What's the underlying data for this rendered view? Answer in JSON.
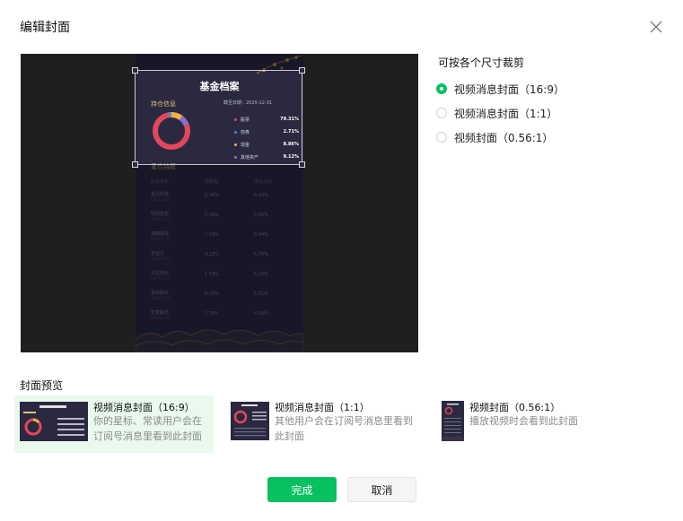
{
  "dialog": {
    "title": "编辑封面"
  },
  "canvas": {
    "doc_title": "基金档案",
    "doc_date": "截至日期：2020-12-31",
    "section_holdings": "持仓信息",
    "legend": [
      {
        "label": "股票",
        "value": "79.31%",
        "color": "#e2475c"
      },
      {
        "label": "债券",
        "value": "2.71%",
        "color": "#4d8ae6"
      },
      {
        "label": "现金",
        "value": "8.86%",
        "color": "#f4b13e"
      },
      {
        "label": "其他资产",
        "value": "9.12%",
        "color": "#8e6cd6"
      }
    ],
    "section_top": "重仓持股",
    "table_headers": [
      "股票名称",
      "涨跌幅",
      "持仓占比"
    ],
    "rows": [
      {
        "name": "金风科技",
        "code": "002202.SZ",
        "chg": "2.36%",
        "pct": "6.63%"
      },
      {
        "name": "明阳智能",
        "code": "601615.SH",
        "chg": "2.09%",
        "pct": "5.96%"
      },
      {
        "name": "海康威视",
        "code": "002415.SZ",
        "chg": "7.33%",
        "pct": "5.94%"
      },
      {
        "name": "京运达",
        "code": "600869.SZ",
        "chg": "4.22%",
        "pct": "5.75%"
      },
      {
        "name": "贝达药业",
        "code": "300558.SZ",
        "chg": "1.54%",
        "pct": "5.22%"
      },
      {
        "name": "金科股份",
        "code": "000656.SZ",
        "chg": "0.70%",
        "pct": "5.01%"
      },
      {
        "name": "宏发股份",
        "code": "600885.SH",
        "chg": "5.79%",
        "pct": "4.95%"
      }
    ]
  },
  "options": {
    "title": "可按各个尺寸裁剪",
    "items": [
      {
        "label": "视频消息封面（16:9）",
        "selected": true
      },
      {
        "label": "视频消息封面（1:1）",
        "selected": false
      },
      {
        "label": "视频封面（0.56:1）",
        "selected": false
      }
    ]
  },
  "preview": {
    "title": "封面预览",
    "cards": [
      {
        "title": "视频消息封面（16:9）",
        "desc": "你的星标、常读用户会在订阅号消息里看到此封面"
      },
      {
        "title": "视频消息封面（1:1）",
        "desc": "其他用户会在订阅号消息里看到此封面"
      },
      {
        "title": "视频封面（0.56:1）",
        "desc": "播放视频时会看到此封面"
      }
    ]
  },
  "buttons": {
    "confirm": "完成",
    "cancel": "取消"
  },
  "colors": {
    "accent": "#07c160",
    "selected_card_bg": "#e9f9ee",
    "canvas_bg": "#1f1f1f",
    "doc_bg": "#2a2940"
  }
}
